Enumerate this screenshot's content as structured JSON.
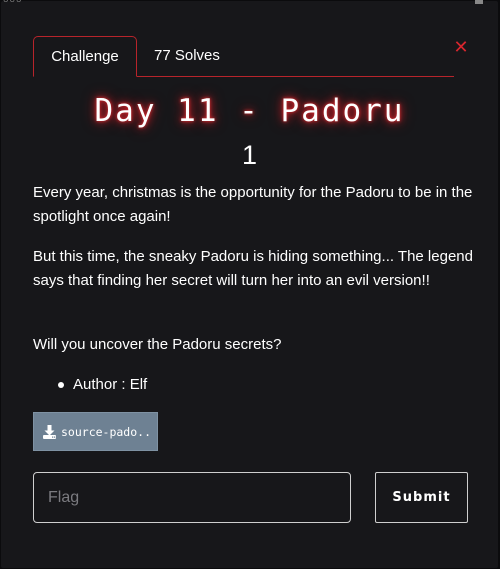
{
  "top_bar": {
    "left_glyph": "ooo"
  },
  "tabs": [
    {
      "label": "Challenge",
      "active": true
    },
    {
      "label": "77 Solves",
      "active": false
    }
  ],
  "close_icon": "close-icon",
  "challenge": {
    "title": "Day 11 - Padoru",
    "points": "1",
    "description": [
      "Every year, christmas is the opportunity for the Padoru to be in the spotlight once again!",
      "But this time, the sneaky Padoru is hiding something... The legend says that finding her secret will turn her into an evil version!!",
      "Will you uncover the Padoru secrets?"
    ],
    "bullets": [
      "Author : Elf"
    ]
  },
  "file": {
    "label": "source-pado...",
    "icon": "download-icon"
  },
  "flag_input": {
    "placeholder": "Flag",
    "value": ""
  },
  "submit": {
    "label": "Submit"
  },
  "colors": {
    "accent": "#b8242b",
    "close": "#d8262e",
    "title_glow": "#d0202a",
    "file_button": "#6e8193",
    "modal_bg": "#17171a",
    "page_bg": "#0b0b0d"
  }
}
